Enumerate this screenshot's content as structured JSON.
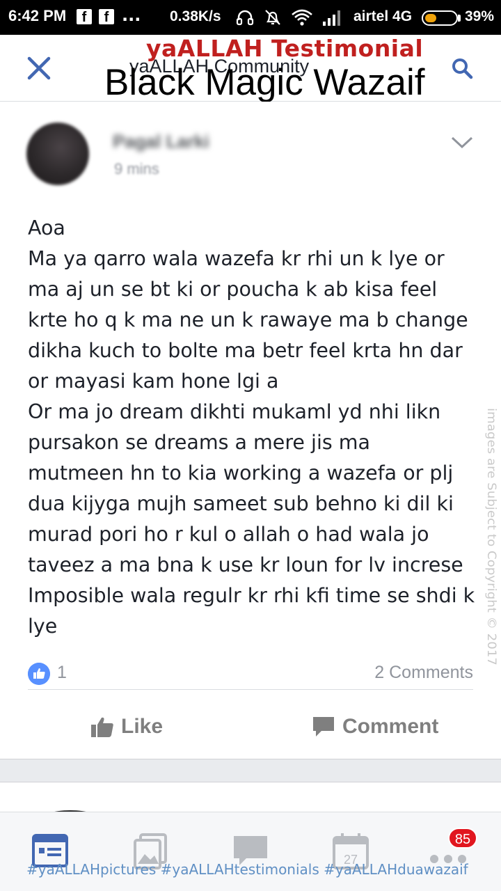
{
  "status_bar": {
    "time": "6:42 PM",
    "notification_icons": [
      "facebook-icon",
      "facebook-icon"
    ],
    "more_dots": "...",
    "speed": "0.38K/s",
    "carrier": "airtel 4G",
    "battery_percent": "39%",
    "battery_level": 0.39
  },
  "header": {
    "title": "yaALLAH Community",
    "close_icon": "close-icon",
    "search_icon": "search-icon"
  },
  "watermark": {
    "title_red": "yaALLAH Testimonial",
    "title_black": "Black Magic Wazaif",
    "side_text": "images are Subject to Copyright © 2017",
    "hashtags": "#yaALLAHpictures #yaALLAHtestimonials #yaALLAHduawazaif"
  },
  "post": {
    "author": "Pagal Larki",
    "time": "9 mins",
    "lines": [
      "Aoa",
      "Ma ya qarro wala wazefa kr rhi  un k lye or",
      "ma aj un se bt ki or poucha k ab kisa feel",
      "krte ho q k ma ne un k rawaye ma b change",
      "dikha kuch to bolte ma betr feel krta hn dar",
      "or mayasi kam hone lgi a",
      "Or ma jo dream dikhti mukaml yd nhi likn",
      "pursakon se dreams a mere  jis ma",
      "mutmeen hn to kia working a wazefa or plj",
      "dua kijyga mujh sameet sub behno ki dil ki",
      "murad pori ho r kul o allah o had wala jo",
      "taveez a ma bna k use kr loun for lv increse",
      "Imposible wala regulr kr rhi kfi time se shdi k",
      "lye"
    ],
    "like_count": "1",
    "comments_count": "2 Comments",
    "like_label": "Like",
    "comment_label": "Comment"
  },
  "bottom_nav": {
    "items": [
      "news-feed-icon",
      "photos-icon",
      "messages-icon",
      "events-icon",
      "more-icon"
    ],
    "events_day": "27",
    "notification_badge": "85"
  },
  "colors": {
    "accent": "#4267b2",
    "icon_blue": "#5890ff",
    "muted": "#90949c",
    "badge": "#e1161f",
    "watermark_red": "#c0201f"
  }
}
